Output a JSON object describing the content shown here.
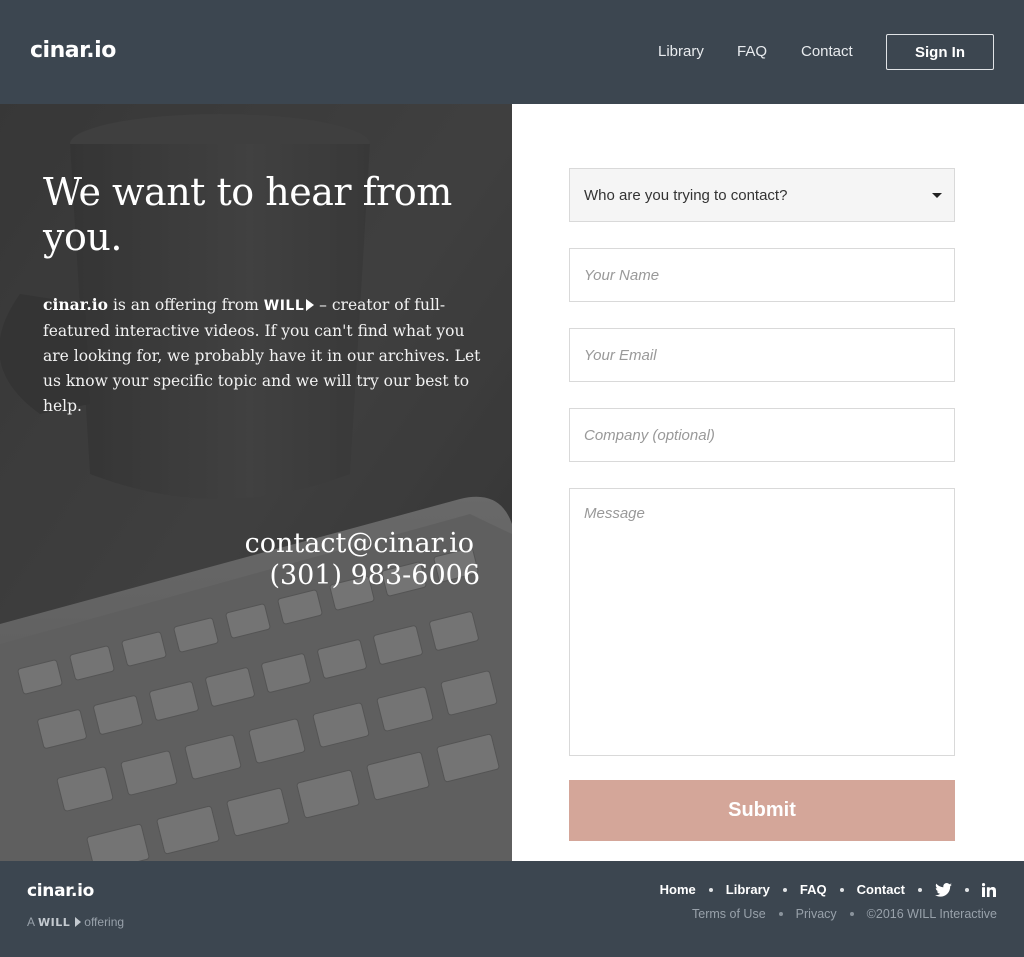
{
  "header": {
    "logo": "cinar.io",
    "nav": [
      "Library",
      "FAQ",
      "Contact"
    ],
    "signin_label": "Sign In"
  },
  "hero": {
    "title": "We want to hear from you.",
    "brand": "cinar.io",
    "body_pre": " is an offering from ",
    "will_logo": "WILL",
    "body_post": " – creator of full-featured interactive videos. If you can't find what you are looking for, we probably have it in our archives. Let us know your specific topic and we will try our best to help.",
    "email": "contact@cinar.io",
    "phone": "(301) 983-6006"
  },
  "form": {
    "select_value": "Who are you trying to contact?",
    "name_placeholder": "Your Name",
    "email_placeholder": "Your Email",
    "company_placeholder": "Company (optional)",
    "message_placeholder": "Message",
    "submit_label": "Submit"
  },
  "footer": {
    "logo": "cinar.io",
    "tag_prefix": "A",
    "tag_will": "WILL",
    "tag_suffix": "offering",
    "nav": [
      "Home",
      "Library",
      "FAQ",
      "Contact"
    ],
    "legal": [
      "Terms of Use",
      "Privacy",
      "©2016 WILL Interactive"
    ],
    "icons": [
      "twitter-icon",
      "linkedin-icon"
    ]
  },
  "colors": {
    "header_bg": "#3c4650",
    "submit_bg": "#d4a699",
    "hero_overlay": "#454545"
  }
}
